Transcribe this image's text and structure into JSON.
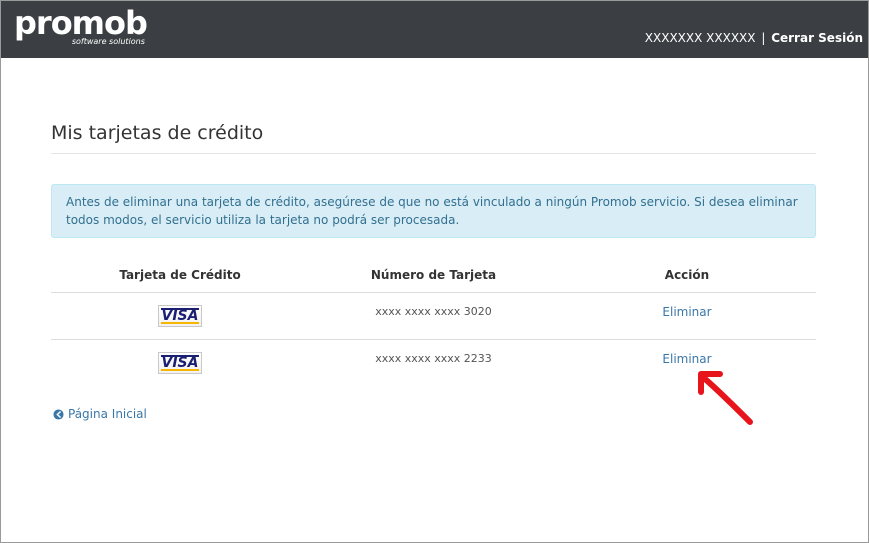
{
  "header": {
    "logo_main": "promob",
    "logo_sub": "software solutions",
    "user_name": "XXXXXXX XXXXXX",
    "separator": "|",
    "logout_label": "Cerrar Sesión"
  },
  "page": {
    "title": "Mis tarjetas de crédito",
    "alert": "Antes de eliminar una tarjeta de crédito, asegúrese de que no está vinculado a ningún Promob servicio. Si desea eliminar todos modos, el servicio utiliza la tarjeta no podrá ser procesada."
  },
  "table": {
    "headers": [
      "Tarjeta de Crédito",
      "Número de Tarjeta",
      "Acción"
    ],
    "rows": [
      {
        "brand": "VISA",
        "number": "xxxx xxxx xxxx 3020",
        "action": "Eliminar"
      },
      {
        "brand": "VISA",
        "number": "xxxx xxxx xxxx 2233",
        "action": "Eliminar"
      }
    ]
  },
  "footer": {
    "home_link": "Página Inicial"
  },
  "colors": {
    "header_bg": "#3b3e42",
    "alert_bg": "#d9edf7",
    "alert_text": "#31708f",
    "link": "#3a77a8",
    "annotation_arrow": "#e8141b"
  },
  "icons": {
    "home_link_icon": "circle-arrow-left-icon",
    "annotation": "red-arrow-icon"
  }
}
